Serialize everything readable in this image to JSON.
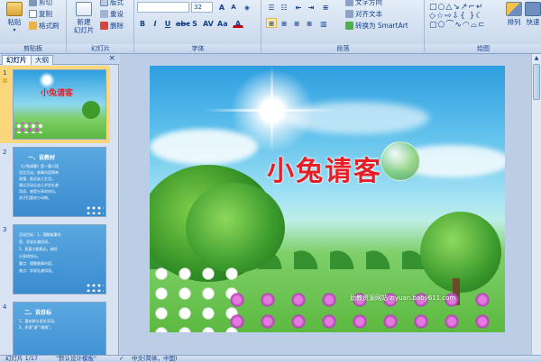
{
  "ribbon": {
    "clipboard": {
      "paste_label": "粘贴",
      "cut_label": "剪切",
      "copy_label": "复制",
      "format_painter_label": "格式刷",
      "group_label": "剪贴板"
    },
    "slides": {
      "new_slide_label_line1": "新建",
      "new_slide_label_line2": "幻灯片",
      "layout_label": "版式",
      "reset_label": "重设",
      "delete_label": "删除",
      "group_label": "幻灯片"
    },
    "font": {
      "font_name": "",
      "font_size": "32",
      "group_label": "字体"
    },
    "paragraph": {
      "text_direction_label": "文字方向",
      "align_text_label": "对齐文本",
      "smartart_label": "转换为 SmartArt",
      "group_label": "段落"
    },
    "drawing": {
      "arrange_label": "排列",
      "quick_styles_label": "快速",
      "group_label": "绘图"
    }
  },
  "left_pane": {
    "tabs": [
      {
        "label": "幻灯片"
      },
      {
        "label": "大纲"
      }
    ],
    "close_glyph": "×",
    "thumbnails": [
      {
        "number": "1",
        "title": "小兔请客",
        "lines": []
      },
      {
        "number": "2",
        "title": "一、说教材",
        "lines": [
          "《小兔请客》是一篇小班",
          "语言活动，故事内容简单",
          "易懂，贴近幼儿生活。",
          "通过活动让幼儿学会礼貌",
          "用语，感受分享的快乐。",
          "孩子们喜欢小动物。"
        ]
      },
      {
        "number": "3",
        "title": "",
        "lines": [
          "活动目标：1、理解故事内",
          "容，学说礼貌用语。",
          "2、愿意大胆表达，体验",
          "分享的快乐。",
          "重点：理解故事内容。",
          "难点：学说礼貌用语。"
        ]
      },
      {
        "number": "4",
        "title": "二、说目标",
        "lines": [
          "1、喜欢参与语言活动。",
          "2、学说\"请\"\"谢谢\"。"
        ]
      }
    ]
  },
  "slide": {
    "title": "小兔请客",
    "watermark": "幼教资源网站 ziyuan.baby611.com"
  },
  "status": {
    "slide_counter": "幻灯片 1/17",
    "theme": "\"默认设计模板\"",
    "language": "中文(简体，中国)"
  }
}
